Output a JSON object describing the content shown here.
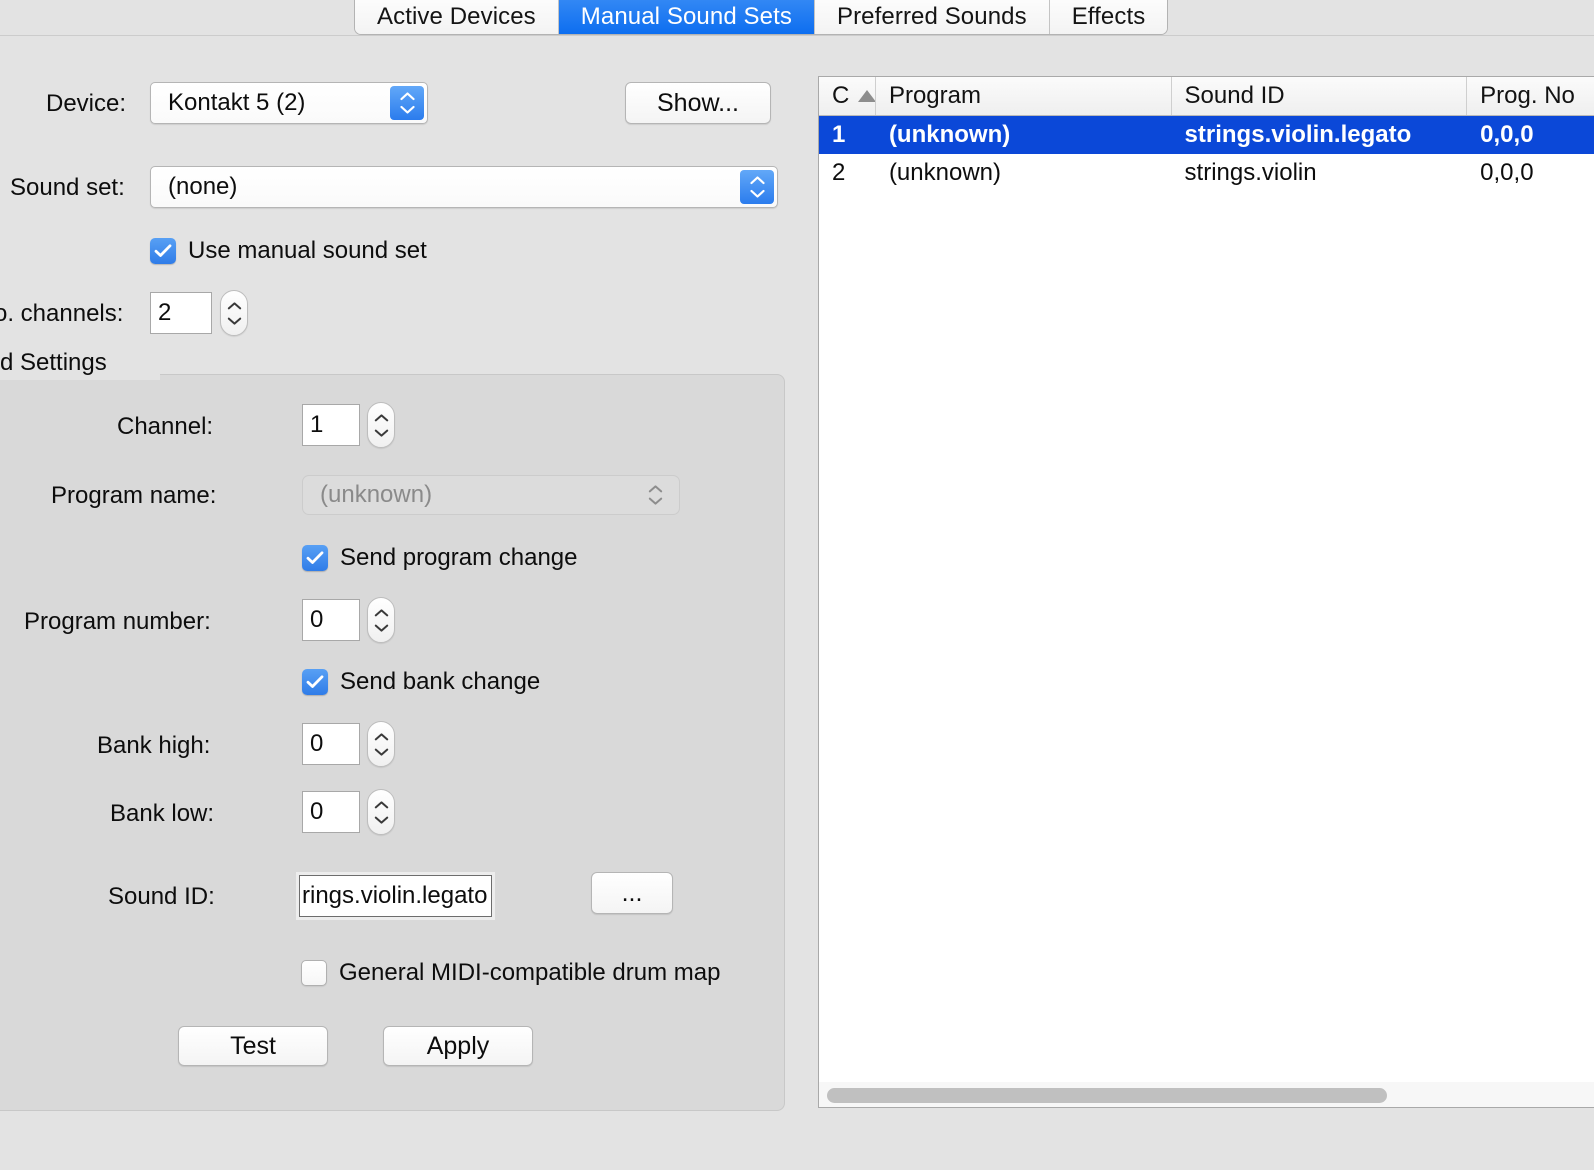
{
  "tabs": [
    {
      "label": "Active Devices",
      "selected": false
    },
    {
      "label": "Manual Sound Sets",
      "selected": true
    },
    {
      "label": "Preferred Sounds",
      "selected": false
    },
    {
      "label": "Effects",
      "selected": false
    }
  ],
  "form": {
    "device_label": "Device:",
    "device_value": "Kontakt 5 (2)",
    "show_button": "Show...",
    "sound_set_label": "Sound set:",
    "sound_set_value": "(none)",
    "use_manual_sound_set": "Use manual sound set",
    "no_channels_label": "o. channels:",
    "no_channels_value": "2"
  },
  "group": {
    "title": "d Settings",
    "channel_label": "Channel:",
    "channel_value": "1",
    "program_name_label": "Program name:",
    "program_name_value": "(unknown)",
    "send_program_change": "Send program change",
    "program_number_label": "Program number:",
    "program_number_value": "0",
    "send_bank_change": "Send bank change",
    "bank_high_label": "Bank high:",
    "bank_high_value": "0",
    "bank_low_label": "Bank low:",
    "bank_low_value": "0",
    "sound_id_label": "Sound ID:",
    "sound_id_value": "rings.violin.legato",
    "browse_button": "...",
    "gm_drum_map": "General MIDI-compatible drum map",
    "test_button": "Test",
    "apply_button": "Apply"
  },
  "table": {
    "columns": [
      {
        "label": "C",
        "sorted": true
      },
      {
        "label": "Program"
      },
      {
        "label": "Sound ID"
      },
      {
        "label": "Prog. No"
      }
    ],
    "rows": [
      {
        "ch": "1",
        "program": "(unknown)",
        "sound_id": "strings.violin.legato",
        "prog_no": "0,0,0",
        "selected": true
      },
      {
        "ch": "2",
        "program": "(unknown)",
        "sound_id": "strings.violin",
        "prog_no": "0,0,0",
        "selected": false
      }
    ]
  },
  "colors": {
    "accent_blue": "#2f7ce8",
    "selection_blue": "#0b48d8",
    "tab_selected_blue": "#0d6ef0",
    "window_bg": "#e3e3e3",
    "groupbox_bg": "#d9d9d9"
  }
}
